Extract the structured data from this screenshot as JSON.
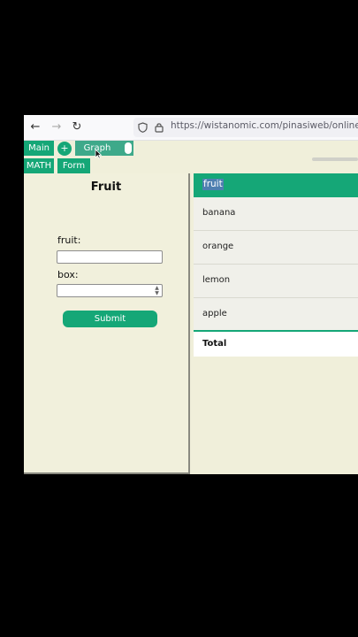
{
  "browser": {
    "url": "https://wistanomic.com/pinasiweb/onlinepina"
  },
  "tabs": {
    "main": "Main",
    "plus": "+",
    "graph": "Graph",
    "math": "MATH",
    "form": "Form"
  },
  "form": {
    "title": "Fruit",
    "fruit_label": "fruit:",
    "fruit_value": "",
    "box_label": "box:",
    "box_value": "",
    "submit": "Submit"
  },
  "table": {
    "header": "fruit",
    "rows": [
      "banana",
      "orange",
      "lemon",
      "apple"
    ],
    "total_label": "Total"
  },
  "colors": {
    "accent": "#15a777",
    "panel_bg": "#f0efda"
  }
}
